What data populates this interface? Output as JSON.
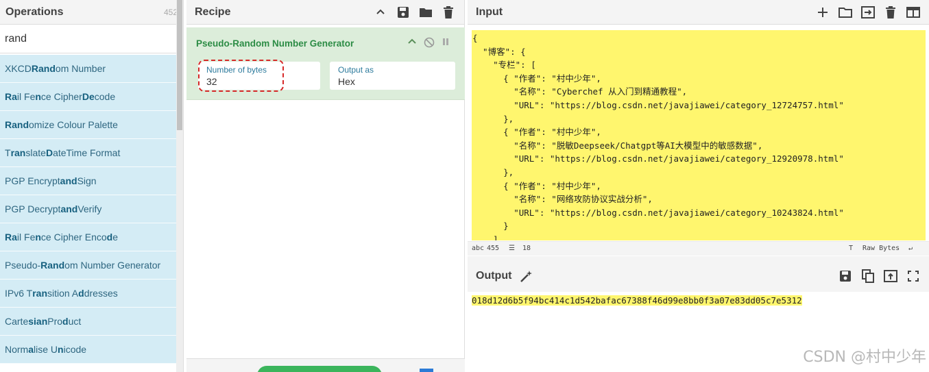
{
  "operations": {
    "title": "Operations",
    "count": "452",
    "search_value": "rand",
    "items": [
      {
        "pre": "XKCD ",
        "b1": "Rand",
        "mid": "om Number",
        "b2": "",
        "post": ""
      },
      {
        "pre": "",
        "b1": "Ra",
        "mid": "il Fe",
        "b2": "n",
        "post": "ce Cipher "
      },
      {
        "pre": "",
        "b1": "Rand",
        "mid": "omize Colour Palette",
        "b2": "",
        "post": ""
      },
      {
        "pre": "T",
        "b1": "ran",
        "mid": "slate ",
        "b2": "D",
        "post": "ateTime Format"
      },
      {
        "pre": "PGP Encrypt ",
        "b1": "and",
        "mid": " Sign",
        "b2": "",
        "post": ""
      },
      {
        "pre": "PGP Decrypt ",
        "b1": "and",
        "mid": " Verify",
        "b2": "",
        "post": ""
      },
      {
        "pre": "",
        "b1": "Ra",
        "mid": "il Fe",
        "b2": "n",
        "post": "ce Cipher Enco"
      },
      {
        "pre": "Pseudo-",
        "b1": "Rand",
        "mid": "om Number Generator",
        "b2": "",
        "post": ""
      },
      {
        "pre": "IPv6 T",
        "b1": "ran",
        "mid": "sition A",
        "b2": "d",
        "post": "dresses"
      },
      {
        "pre": "Carte",
        "b1": "sian",
        "mid": " Pro",
        "b2": "d",
        "post": "uct"
      },
      {
        "pre": "Norm",
        "b1": "a",
        "mid": "lise U",
        "b2": "n",
        "post": "icode"
      }
    ],
    "labels": [
      "XKCD Random Number",
      "Rail Fence Cipher Decode",
      "Randomize Colour Palette",
      "Translate DateTime Format",
      "PGP Encrypt and Sign",
      "PGP Decrypt and Verify",
      "Rail Fence Cipher Encode",
      "Pseudo-Random Number Generator",
      "IPv6 Transition Addresses",
      "Cartesian Product",
      "Normalise Unicode"
    ]
  },
  "recipe": {
    "title": "Recipe",
    "operation_name": "Pseudo-Random Number Generator",
    "bytes_label": "Number of bytes",
    "bytes_value": "32",
    "output_label": "Output as",
    "output_value": "Hex"
  },
  "input": {
    "title": "Input",
    "text": "{\n  \"博客\": {\n    \"专栏\": [\n      { \"作者\": \"村中少年\",\n        \"名称\": \"Cyberchef 从入门到精通教程\",\n        \"URL\": \"https://blog.csdn.net/javajiawei/category_12724757.html\"\n      },\n      { \"作者\": \"村中少年\",\n        \"名称\": \"脱敏Deepseek/Chatgpt等AI大模型中的敏感数据\",\n        \"URL\": \"https://blog.csdn.net/javajiawei/category_12920978.html\"\n      },\n      { \"作者\": \"村中少年\",\n        \"名称\": \"网络攻防协议实战分析\",\n        \"URL\": \"https://blog.csdn.net/javajiawei/category_10243824.html\"\n      }\n    ]",
    "char_count": "455",
    "line_count": "18",
    "raw_bytes_label": "Raw Bytes"
  },
  "output": {
    "title": "Output",
    "value": "018d12d6b5f94bc414c1d542bafac67388f46d99e8bb0f3a07e83dd05c7e5312"
  },
  "watermark": "CSDN @村中少年"
}
